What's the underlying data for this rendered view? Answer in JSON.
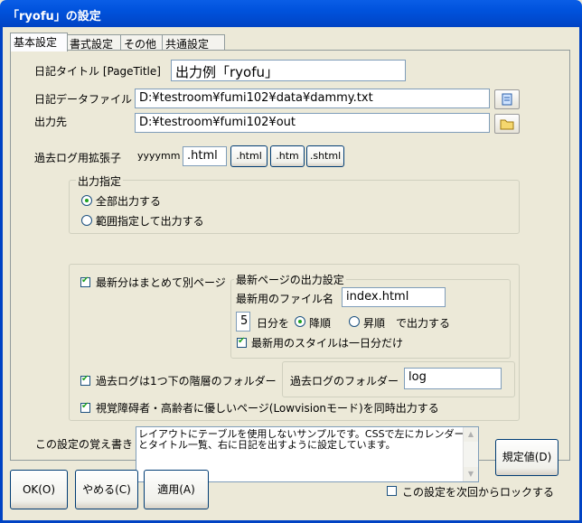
{
  "window": {
    "title": "「ryofu」の設定"
  },
  "tabs": [
    "基本設定",
    "書式設定",
    "その他",
    "共通設定"
  ],
  "diary_title": {
    "label": "日記タイトル [PageTitle]",
    "value": "出力例「ryofu」"
  },
  "diary_file": {
    "label": "日記データファイル",
    "value": "D:¥testroom¥fumi102¥data¥dammy.txt"
  },
  "output_dir": {
    "label": "出力先",
    "value": "D:¥testroom¥fumi102¥out"
  },
  "ext": {
    "label": "過去ログ用拡張子",
    "prefix": "yyyymm",
    "value": ".html",
    "buttons": [
      ".html",
      ".htm",
      ".shtml"
    ]
  },
  "output_spec": {
    "title": "出力指定",
    "all": "全部出力する",
    "range": "範囲指定して出力する"
  },
  "latest": {
    "checkbox": "最新分はまとめて別ページ",
    "group_title": "最新ページの出力設定",
    "filename_label": "最新用のファイル名",
    "filename_value": "index.html",
    "days_value": "5",
    "days_label": "日分を",
    "desc": "降順",
    "asc": "昇順",
    "output_label": "で出力する",
    "style_checkbox": "最新用のスタイルは一日分だけ"
  },
  "past_folder": {
    "checkbox": "過去ログは1つ下の階層のフォルダー",
    "label": "過去ログのフォルダー",
    "value": "log"
  },
  "lowvision": {
    "checkbox": "視覚障碍者・高齢者に優しいページ(Lowvisionモード)を同時出力する"
  },
  "memo": {
    "label": "この設定の覚え書き",
    "line1": "レイアウトにテーブルを使用しないサンプルです。CSSで左にカレンダー",
    "line2": "とタイトル一覧、右に日記を出すように設定しています。"
  },
  "buttons": {
    "default": "規定値(D)",
    "ok": "OK(O)",
    "cancel": "やめる(C)",
    "apply": "適用(A)"
  },
  "lock": {
    "label": "この設定を次回からロックする"
  },
  "colors": {
    "titlebar": "#0054e3",
    "face": "#ece9d8",
    "check": "#21a121"
  }
}
